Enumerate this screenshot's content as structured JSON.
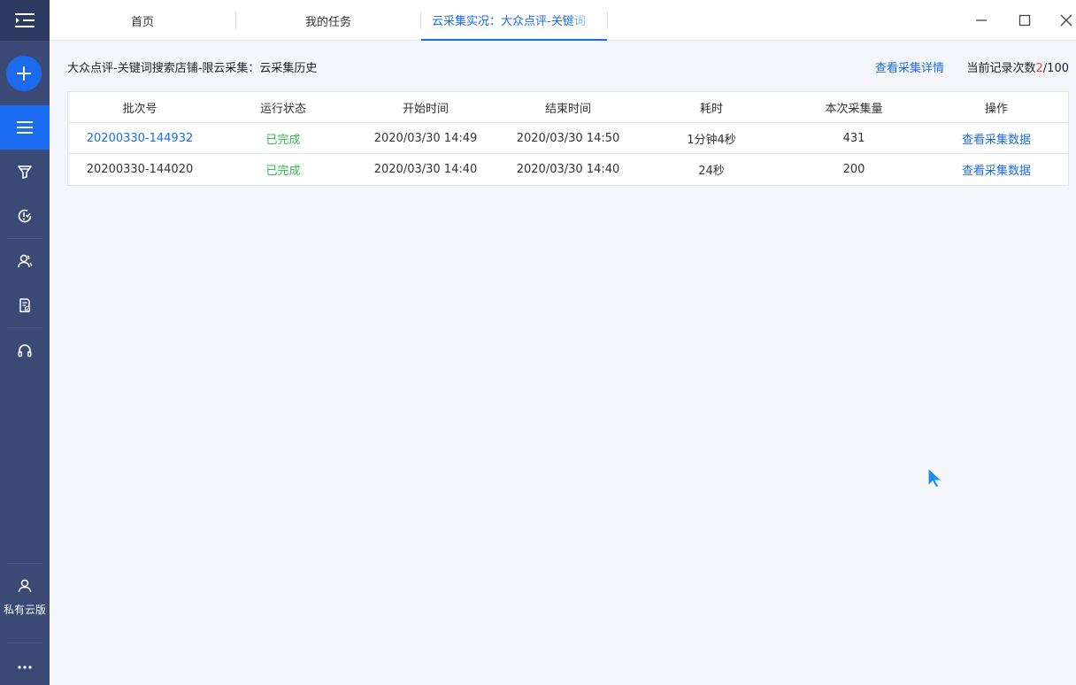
{
  "sidebar": {
    "user_label": "私有云版"
  },
  "tabs": [
    {
      "label": "首页"
    },
    {
      "label": "我的任务"
    },
    {
      "label": "云采集实况：大众点评-关键词"
    }
  ],
  "header": {
    "title": "大众点评-关键词搜索店铺-限云采集：云采集历史",
    "detail_link": "查看采集详情",
    "record_prefix": "当前记录次数",
    "record_current": "2",
    "record_total": "/100"
  },
  "table": {
    "columns": [
      "批次号",
      "运行状态",
      "开始时间",
      "结束时间",
      "耗时",
      "本次采集量",
      "操作"
    ],
    "rows": [
      {
        "batch": "20200330-144932",
        "status": "已完成",
        "start": "2020/03/30 14:49",
        "end": "2020/03/30 14:50",
        "duration": "1分钟4秒",
        "count": "431",
        "action": "查看采集数据"
      },
      {
        "batch": "20200330-144020",
        "status": "已完成",
        "start": "2020/03/30 14:40",
        "end": "2020/03/30 14:40",
        "duration": "24秒",
        "count": "200",
        "action": "查看采集数据"
      }
    ]
  },
  "colors": {
    "accent": "#1a6bf0",
    "success": "#36b84a",
    "sidebar": "#3a4a75",
    "highlight": "#e8432e"
  }
}
